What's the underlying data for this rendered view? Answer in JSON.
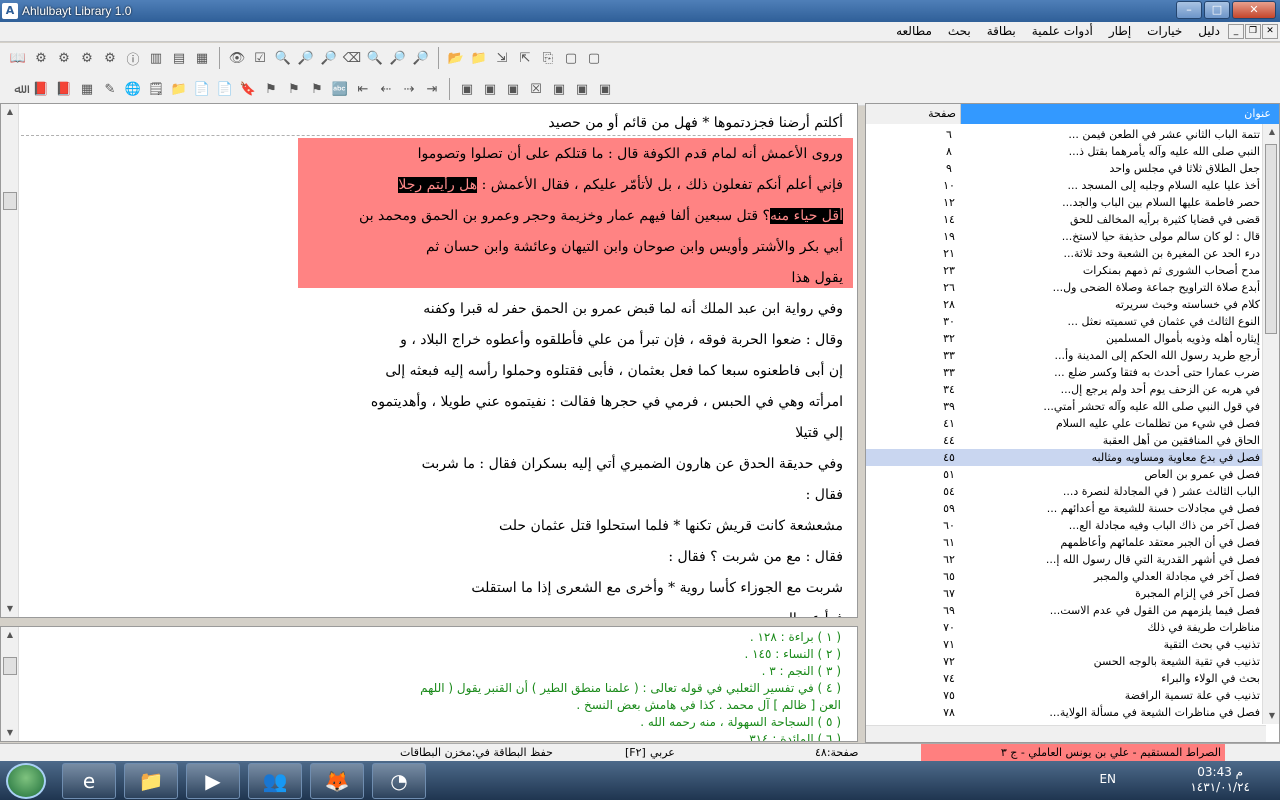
{
  "window": {
    "title": "Ahlulbayt Library 1.0"
  },
  "menu": [
    "مطالعه",
    "بحث",
    "بطاقة",
    "أدوات علمية",
    "إطار",
    "خيارات",
    "دليل"
  ],
  "reader": {
    "lines": [
      "أكلتم أرضنا فجزدتموها * فهل من قائم أو من حصيد",
      "وروى الأعمش أنه لمام قدم الكوفة قال : ما قتلكم على أن تصلوا وتصوموا",
      "فإني أعلم أنكم تفعلون ذلك ، بل لأتأمّر عليكم ، فقال الأعمش :",
      "؟ قتل سبعين ألفا فيهم عمار وخزيمة وحجر وعمرو بن الحمق ومحمد بن",
      "أبي بكر والأشتر وأويس وابن صوحان وابن التيهان وعائشة وابن حسان ثم",
      "يقول هذا",
      "وفي رواية ابن عبد الملك أنه لما قبض عمرو بن الحمق حفر له قبرا وكفنه",
      "وقال : ضعوا الحربة فوقه ، فإن تبرأ من علي فأطلقوه وأعطوه خراج البلاد ، و",
      "إن أبى فاطعنوه سبعا كما فعل بعثمان ، فأبى فقتلوه وحملوا رأسه إليه فبعثه إلى",
      "امرأته وهي في الحبس ، فرمي في حجرها فقالت : نفيتموه عني طويلا ، وأهديتموه",
      "إلي قتيلا",
      "وفي حديقة الحدق عن هارون الضميري أتي إليه بسكران فقال : ما شربت",
      "فقال :",
      "مشعشعة كانت قريش تكنها * فلما استحلوا قتل عثمان حلت",
      "فقال : مع من شربت ؟ فقال :",
      "شربت مع الجوزاء كأسا روية * وأخرى مع الشعرى إذا ما استقلت",
      "فرأ عن الحد"
    ],
    "selected_1": "هل رأيتم رجلا",
    "selected_2": "أقل حياء منه"
  },
  "footnotes": [
    "( ١ ) براءة : ١٢٨ .",
    "( ٢ ) النساء : ١٤٥ .",
    "( ٣ ) النجم : ٣ .",
    "( ٤ ) في تفسير الثعلبي في قوله تعالى : ( علمنا منطق الطير ) أن القنبر يقول ( اللهم",
    "العن [ ظالم ] آل محمد . كذا في هامش بعض النسخ .",
    "( ٥ ) السجاحة السهولة ، منه رحمه الله .",
    "( ٦ ) المائدة : ٣١٤"
  ],
  "index": {
    "col_title": "عنوان",
    "col_page": "صفحة",
    "rows": [
      {
        "t": "تتمة الباب الثاني عشر في الطعن فيمن ...",
        "p": "٦"
      },
      {
        "t": "النبي صلى الله عليه وآله يأمرهما بقتل ذ...",
        "p": "٨"
      },
      {
        "t": "جعل الطلاق ثلاثا في مجلس واحد",
        "p": "٩"
      },
      {
        "t": "أخذ عليا عليه السلام وجلبه إلى المسجد ...",
        "p": "١٠"
      },
      {
        "t": "حصر فاطمة عليها السلام بين الباب والجد...",
        "p": "١٢"
      },
      {
        "t": "قضى في قضايا كثيرة برأيه المخالف للحق",
        "p": "١٤"
      },
      {
        "t": "قال : لو كان سالم مولى حذيفة حيا لاستخ...",
        "p": "١٩"
      },
      {
        "t": "درء الحد عن المغيرة بن الشعبة وحد ثلاثة...",
        "p": "٢١"
      },
      {
        "t": "مدح أصحاب الشورى ثم ذمهم بمنكرات",
        "p": "٢٣"
      },
      {
        "t": "أبدع صلاة التراويح جماعة وصلاة الضحى ول...",
        "p": "٢٦"
      },
      {
        "t": "كلام في خساسته وخبث سريرته",
        "p": "٢٨"
      },
      {
        "t": "النوع الثالث في عثمان في تسميته نعثل ...",
        "p": "٣٠"
      },
      {
        "t": "إيثاره أهله وذويه بأموال المسلمين",
        "p": "٣٢"
      },
      {
        "t": "أرجع طريد رسول الله الحكم إلى المدينة وأ...",
        "p": "٣٣"
      },
      {
        "t": "ضرب عمارا حتى أحدث به فتقا وكسر ضلع ...",
        "p": "٣٣"
      },
      {
        "t": "في هربه عن الزحف يوم أحد ولم يرجع إل...",
        "p": "٣٤"
      },
      {
        "t": "في قول النبي صلى الله عليه وآله تحشر أمتي...",
        "p": "٣٩"
      },
      {
        "t": "فصل في شيء من تظلمات علي عليه السلام",
        "p": "٤١"
      },
      {
        "t": "الحاق في المنافقين من أهل العقبة",
        "p": "٤٤"
      },
      {
        "t": "فصل في بدع معاوية ومساويه ومثالبه",
        "p": "٤٥"
      },
      {
        "t": "فصل في عمرو بن العاص",
        "p": "٥١"
      },
      {
        "t": "الباب الثالث عشر ( في المجادلة لنصرة د...",
        "p": "٥٤"
      },
      {
        "t": "فصل في مجادلات حسنة للشيعة مع أعدائهم ...",
        "p": "٥٩"
      },
      {
        "t": "فصل آخر من ذاك الباب وفيه مجادلة الع...",
        "p": "٦٠"
      },
      {
        "t": "فصل في أن الجبر معتقد علمائهم وأعاظمهم",
        "p": "٦١"
      },
      {
        "t": "فصل في أشهر القدرية التي قال رسول الله إ...",
        "p": "٦٢"
      },
      {
        "t": "فصل آخر في مجادلة العدلي والمجبر",
        "p": "٦٥"
      },
      {
        "t": "فصل آخر في إلزام المجبرة",
        "p": "٦٧"
      },
      {
        "t": "فصل فيما يلزمهم من القول في عدم الاست...",
        "p": "٦٩"
      },
      {
        "t": "مناظرات طريفة في ذلك",
        "p": "٧٠"
      },
      {
        "t": "تذنيب في بحث التقية",
        "p": "٧١"
      },
      {
        "t": "تذنيب في تقية الشيعة بالوجه الحسن",
        "p": "٧٢"
      },
      {
        "t": "بحث في الولاء والبراء",
        "p": "٧٤"
      },
      {
        "t": "تذنيب في علة تسمية الرافضة",
        "p": "٧٥"
      },
      {
        "t": "فصل في مناظرات الشيعة في مسألة الولاية...",
        "p": "٧٨"
      }
    ],
    "active_index": 19
  },
  "status": {
    "page": "صفحة:٤٨",
    "lang": "عربي",
    "key": "[F٢]",
    "save": "حفظ البطاقة في:مخزن البطاقات",
    "book": "الصراط المستقيم - علي بن يونس العاملي - ج ٣"
  },
  "taskbar": {
    "lang": "EN",
    "time": "03:43 م",
    "date": "١٤٣١/٠١/٢٤"
  },
  "colors": {
    "highlight": "#ff8383",
    "footnote": "#1a8a1a",
    "accent": "#3399ff"
  }
}
